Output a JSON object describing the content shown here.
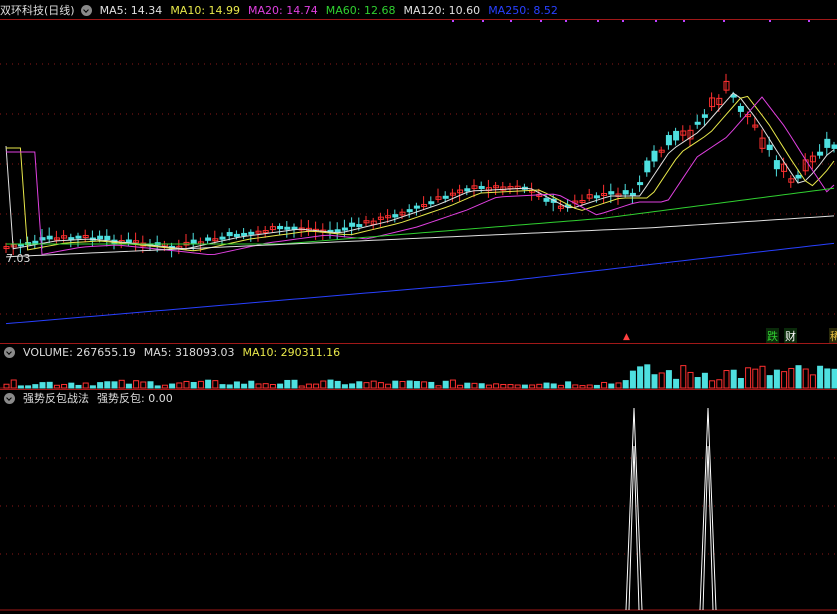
{
  "main_header": {
    "title": "双环科技(日线)",
    "ma": [
      {
        "label": "MA5: 14.34",
        "color": "#e0e0e0"
      },
      {
        "label": "MA10: 14.99",
        "color": "#e8e84a"
      },
      {
        "label": "MA20: 14.74",
        "color": "#e040e0"
      },
      {
        "label": "MA60: 12.68",
        "color": "#30d030"
      },
      {
        "label": "MA120: 10.60",
        "color": "#e0e0e0"
      },
      {
        "label": "MA250: 8.52",
        "color": "#2840ff"
      }
    ]
  },
  "price_label": "7.03",
  "badges": {
    "die": "跌",
    "cai": "财"
  },
  "volume_header": {
    "title": "VOLUME: 267655.19",
    "ma5": "MA5: 318093.03",
    "ma10": "MA10: 290311.16"
  },
  "indicator_header": {
    "title": "强势反包战法",
    "value": "强势反包: 0.00"
  },
  "colors": {
    "up": "#ff3030",
    "down": "#4ee0e0",
    "grid": "#8a1818"
  },
  "chart_data": {
    "type": "candlestick",
    "low_marker": 7.03,
    "ma_latest": {
      "MA5": 14.34,
      "MA10": 14.99,
      "MA20": 14.74,
      "MA60": 12.68,
      "MA120": 10.6,
      "MA250": 8.52
    },
    "indicator_spikes": 2
  }
}
